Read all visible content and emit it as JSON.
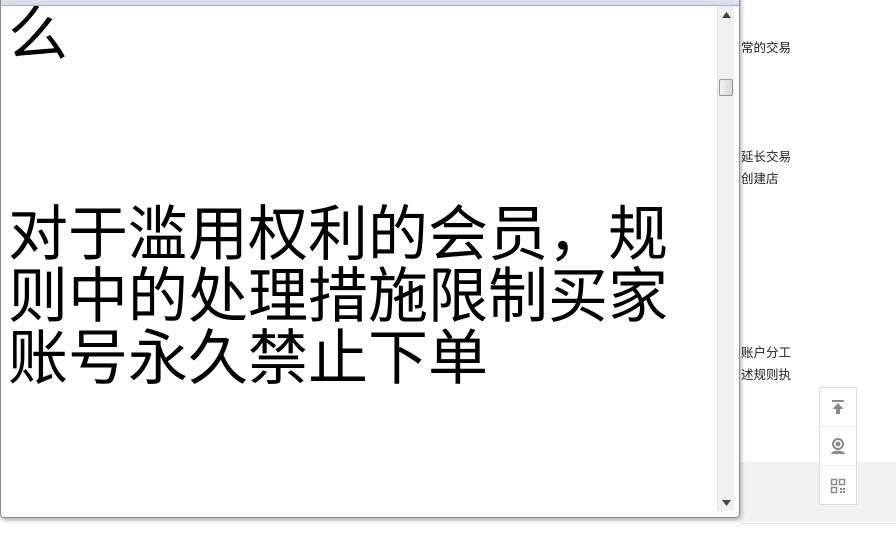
{
  "window": {
    "title_fragment": "…( ) …( ) …( ) … ( ) … ( )"
  },
  "document": {
    "lines": [
      "么",
      "对于滥用权利的会员，规",
      "则中的处理措施限制买家",
      "账号永久禁止下单"
    ]
  },
  "background": {
    "snippets": [
      "常的交易",
      "延长交易",
      "创建店",
      "账户分工",
      "述规则执"
    ]
  },
  "side_toolbar": {
    "icons": [
      "arrow-to-top-icon",
      "customer-service-icon",
      "qr-code-icon"
    ]
  }
}
